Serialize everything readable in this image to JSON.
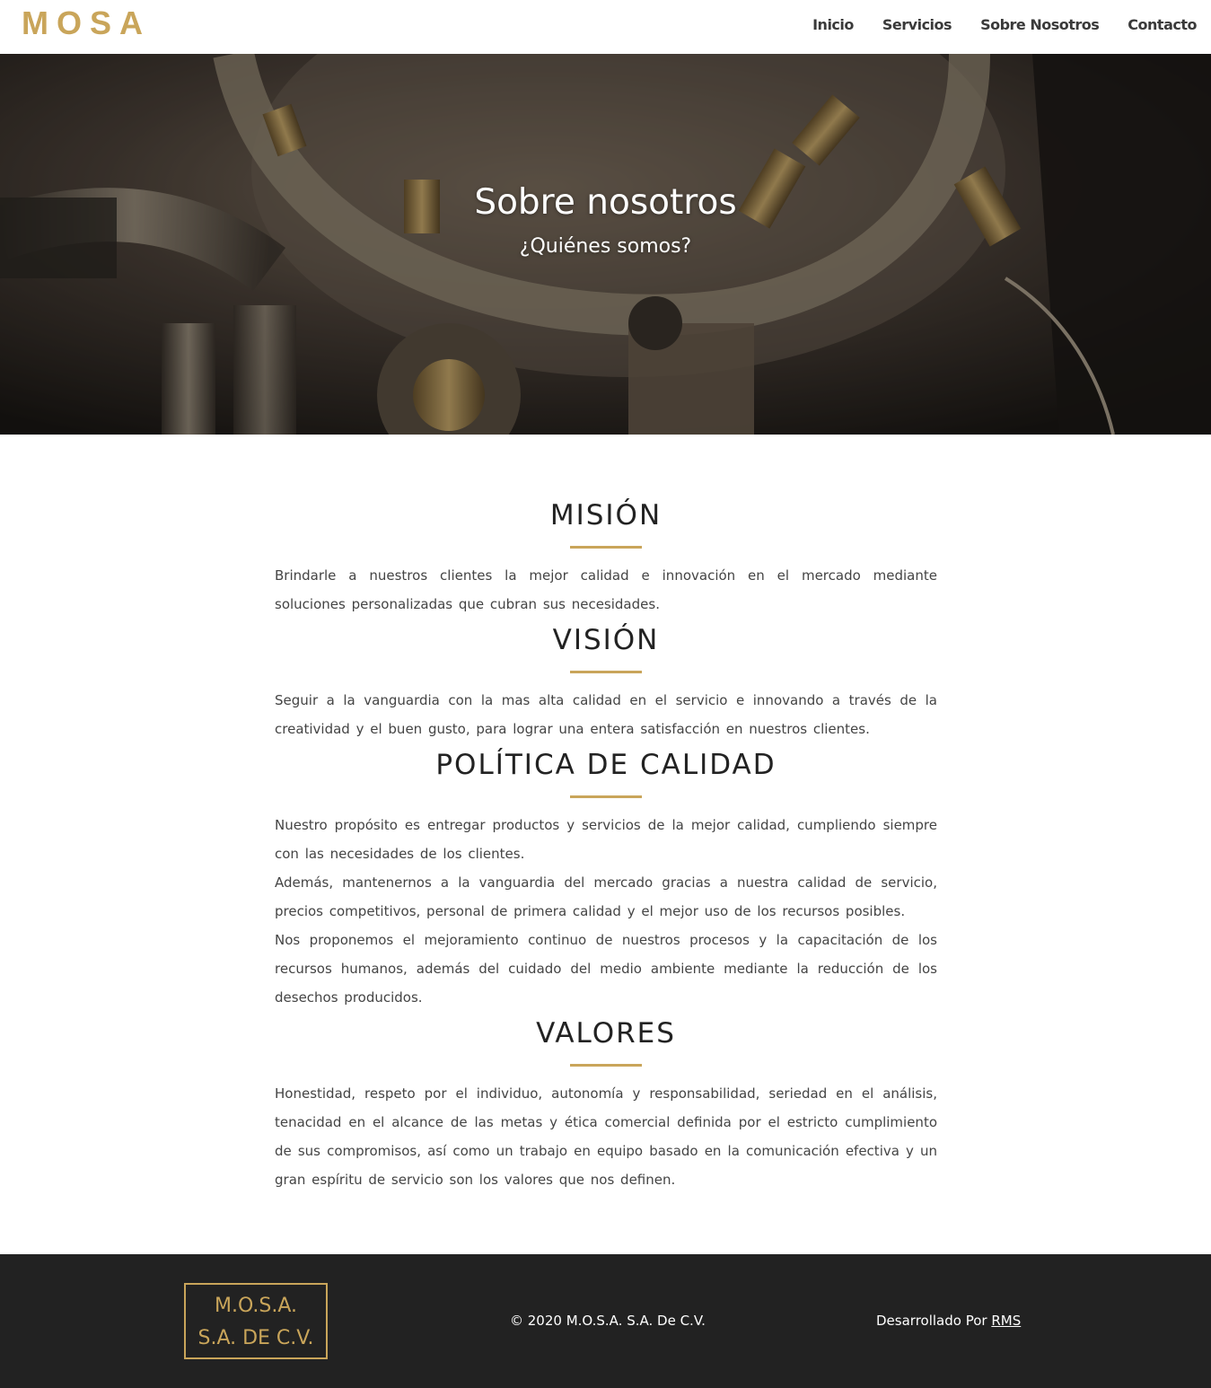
{
  "header": {
    "brand": "MOSA",
    "nav": [
      "Inicio",
      "Servicios",
      "Sobre Nosotros",
      "Contacto"
    ]
  },
  "hero": {
    "title": "Sobre nosotros",
    "subtitle": "¿Quiénes somos?"
  },
  "sections": [
    {
      "title": "MISIÓN",
      "paragraphs": [
        "Brindarle a nuestros clientes la mejor calidad e innovación en el mercado mediante soluciones personalizadas que cubran sus necesidades."
      ]
    },
    {
      "title": "VISIÓN",
      "paragraphs": [
        "Seguir a la vanguardia con la mas alta calidad en el servicio e innovando a través de la creatividad y el buen gusto, para lograr una entera satisfacción en nuestros clientes."
      ]
    },
    {
      "title": "POLÍTICA DE CALIDAD",
      "paragraphs": [
        "Nuestro propósito es entregar productos y servicios de la mejor calidad, cumpliendo siempre con las necesidades de los clientes.",
        "Además, mantenernos a la vanguardia del mercado gracias a nuestra calidad de servicio, precios competitivos, personal de primera calidad y el mejor uso de los recursos posibles.",
        "Nos proponemos el mejoramiento continuo de nuestros procesos y la capacitación de los recursos humanos, además del cuidado del medio ambiente mediante la reducción de los desechos producidos."
      ]
    },
    {
      "title": "VALORES",
      "paragraphs": [
        "Honestidad, respeto por el individuo, autonomía y responsabilidad, seriedad en el análisis, tenacidad en el alcance de las metas y ética comercial definida por el estricto cumplimiento de sus compromisos, así como un trabajo en equipo basado en la comunicación efectiva y un gran espíritu de servicio son los valores que nos definen."
      ]
    }
  ],
  "footer": {
    "logo_line1": "M.O.S.A.",
    "logo_line2": "S.A. DE C.V.",
    "copyright": "© 2020 M.O.S.A. S.A. De C.V.",
    "developed_prefix": "Desarrollado Por",
    "developed_link": "RMS"
  },
  "colors": {
    "accent": "#c9a55a",
    "footer_bg": "#222222"
  }
}
